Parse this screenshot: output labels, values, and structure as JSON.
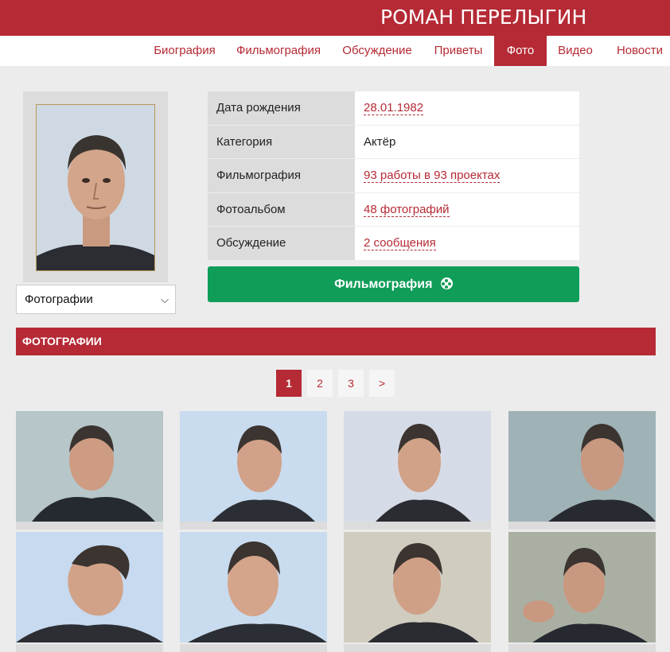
{
  "header": {
    "title": "РОМАН ПЕРЕЛЫГИН"
  },
  "nav": {
    "items": [
      {
        "label": "Биография"
      },
      {
        "label": "Фильмография"
      },
      {
        "label": "Обсуждение"
      },
      {
        "label": "Приветы"
      },
      {
        "label": "Фото"
      },
      {
        "label": "Видео"
      },
      {
        "label": "Новости"
      }
    ],
    "active": "Фото"
  },
  "sidebar": {
    "select_value": "Фотографии"
  },
  "info": {
    "rows": [
      {
        "label": "Дата рождения",
        "value": "28.01.1982"
      },
      {
        "label": "Категория",
        "value": "Актёр"
      },
      {
        "label": "Фильмография",
        "value": "93 работы в 93 проектах"
      },
      {
        "label": "Фотоальбом",
        "value": "48 фотографий"
      },
      {
        "label": "Обсуждение",
        "value": "2 сообщения"
      }
    ]
  },
  "film_button": {
    "label": "Фильмография"
  },
  "section": {
    "title": "ФОТОГРАФИИ"
  },
  "pager": {
    "pages": [
      "1",
      "2",
      "3",
      ">"
    ],
    "current": "1"
  },
  "colors": {
    "brand": "#b52a35",
    "button": "#0f9d58",
    "background": "#ececec"
  }
}
